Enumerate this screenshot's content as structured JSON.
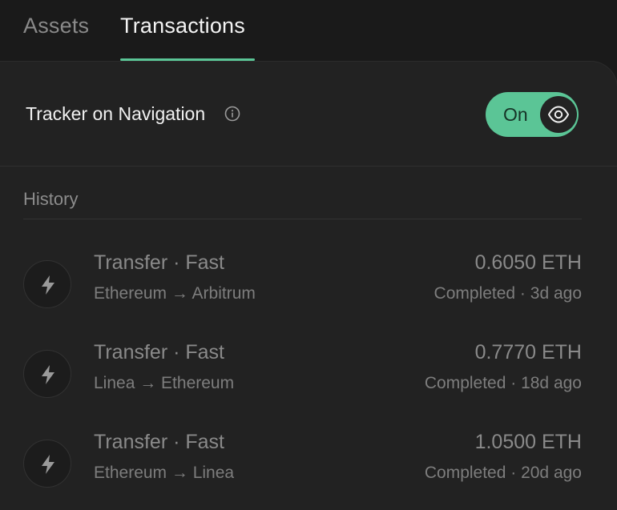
{
  "tabs": {
    "assets_label": "Assets",
    "transactions_label": "Transactions",
    "active": "Transactions"
  },
  "tracker": {
    "label": "Tracker on Navigation",
    "info_icon": "info-icon",
    "toggle_label": "On",
    "toggle_icon": "eye-icon",
    "toggle_state": true
  },
  "history": {
    "title": "History",
    "items": [
      {
        "title": "Transfer · Fast",
        "route": "Ethereum → Arbitrum",
        "amount": "0.6050 ETH",
        "status": "Completed · 3d ago",
        "icon": "lightning-icon"
      },
      {
        "title": "Transfer · Fast",
        "route": "Linea → Ethereum",
        "amount": "0.7770 ETH",
        "status": "Completed · 18d ago",
        "icon": "lightning-icon"
      },
      {
        "title": "Transfer · Fast",
        "route": "Ethereum → Linea",
        "amount": "1.0500 ETH",
        "status": "Completed · 20d ago",
        "icon": "lightning-icon"
      }
    ]
  },
  "colors": {
    "background": "#1a1a1a",
    "panel": "#222222",
    "accent": "#5bc596",
    "text_primary": "#f1f1f1",
    "text_muted": "#8a8a8a"
  }
}
